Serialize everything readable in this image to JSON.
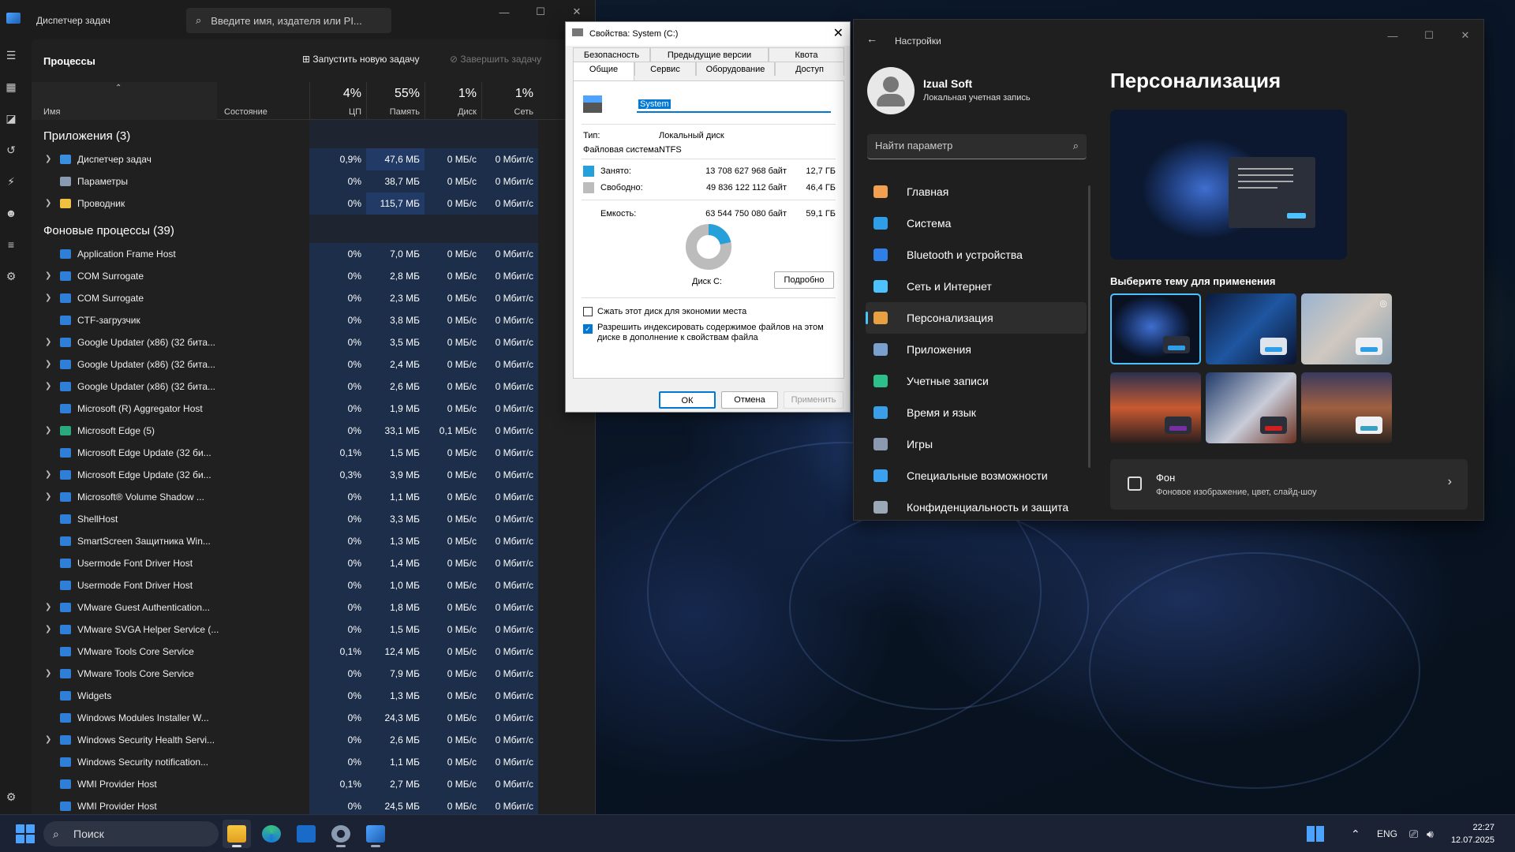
{
  "task_manager": {
    "title": "Диспетчер задач",
    "search_placeholder": "Введите имя, издателя или PI...",
    "section": "Процессы",
    "run_task": "Запустить новую задачу",
    "end_task": "Завершить задачу",
    "columns": {
      "name": "Имя",
      "status": "Состояние",
      "cpu_pct": "4%",
      "cpu": "ЦП",
      "mem_pct": "55%",
      "mem": "Память",
      "disk_pct": "1%",
      "disk": "Диск",
      "net_pct": "1%",
      "net": "Сеть"
    },
    "apps_group": "Приложения (3)",
    "bg_group": "Фоновые процессы (39)",
    "apps": [
      {
        "name": "Диспетчер задач",
        "expand": true,
        "cpu": "0,9%",
        "mem": "47,6 МБ",
        "disk": "0 МБ/с",
        "net": "0 Мбит/с",
        "icon": "task-manager-icon"
      },
      {
        "name": "Параметры",
        "expand": false,
        "cpu": "0%",
        "mem": "38,7 МБ",
        "disk": "0 МБ/с",
        "net": "0 Мбит/с",
        "icon": "settings-gear-icon"
      },
      {
        "name": "Проводник",
        "expand": true,
        "cpu": "0%",
        "mem": "115,7 МБ",
        "disk": "0 МБ/с",
        "net": "0 Мбит/с",
        "icon": "folder-icon"
      }
    ],
    "background": [
      {
        "name": "Application Frame Host",
        "expand": false,
        "cpu": "0%",
        "mem": "7,0 МБ",
        "disk": "0 МБ/с",
        "net": "0 Мбит/с"
      },
      {
        "name": "COM Surrogate",
        "expand": true,
        "cpu": "0%",
        "mem": "2,8 МБ",
        "disk": "0 МБ/с",
        "net": "0 Мбит/с"
      },
      {
        "name": "COM Surrogate",
        "expand": true,
        "cpu": "0%",
        "mem": "2,3 МБ",
        "disk": "0 МБ/с",
        "net": "0 Мбит/с"
      },
      {
        "name": "CTF-загрузчик",
        "expand": false,
        "cpu": "0%",
        "mem": "3,8 МБ",
        "disk": "0 МБ/с",
        "net": "0 Мбит/с"
      },
      {
        "name": "Google Updater (x86) (32 бита...",
        "expand": true,
        "cpu": "0%",
        "mem": "3,5 МБ",
        "disk": "0 МБ/с",
        "net": "0 Мбит/с"
      },
      {
        "name": "Google Updater (x86) (32 бита...",
        "expand": true,
        "cpu": "0%",
        "mem": "2,4 МБ",
        "disk": "0 МБ/с",
        "net": "0 Мбит/с"
      },
      {
        "name": "Google Updater (x86) (32 бита...",
        "expand": true,
        "cpu": "0%",
        "mem": "2,6 МБ",
        "disk": "0 МБ/с",
        "net": "0 Мбит/с"
      },
      {
        "name": "Microsoft (R) Aggregator Host",
        "expand": false,
        "cpu": "0%",
        "mem": "1,9 МБ",
        "disk": "0 МБ/с",
        "net": "0 Мбит/с"
      },
      {
        "name": "Microsoft Edge (5)",
        "expand": true,
        "cpu": "0%",
        "mem": "33,1 МБ",
        "disk": "0,1 МБ/с",
        "net": "0 Мбит/с"
      },
      {
        "name": "Microsoft Edge Update (32 би...",
        "expand": false,
        "cpu": "0,1%",
        "mem": "1,5 МБ",
        "disk": "0 МБ/с",
        "net": "0 Мбит/с"
      },
      {
        "name": "Microsoft Edge Update (32 би...",
        "expand": true,
        "cpu": "0,3%",
        "mem": "3,9 МБ",
        "disk": "0 МБ/с",
        "net": "0 Мбит/с"
      },
      {
        "name": "Microsoft® Volume Shadow ...",
        "expand": true,
        "cpu": "0%",
        "mem": "1,1 МБ",
        "disk": "0 МБ/с",
        "net": "0 Мбит/с"
      },
      {
        "name": "ShellHost",
        "expand": false,
        "cpu": "0%",
        "mem": "3,3 МБ",
        "disk": "0 МБ/с",
        "net": "0 Мбит/с"
      },
      {
        "name": "SmartScreen Защитника Win...",
        "expand": false,
        "cpu": "0%",
        "mem": "1,3 МБ",
        "disk": "0 МБ/с",
        "net": "0 Мбит/с"
      },
      {
        "name": "Usermode Font Driver Host",
        "expand": false,
        "cpu": "0%",
        "mem": "1,4 МБ",
        "disk": "0 МБ/с",
        "net": "0 Мбит/с"
      },
      {
        "name": "Usermode Font Driver Host",
        "expand": false,
        "cpu": "0%",
        "mem": "1,0 МБ",
        "disk": "0 МБ/с",
        "net": "0 Мбит/с"
      },
      {
        "name": "VMware Guest Authentication...",
        "expand": true,
        "cpu": "0%",
        "mem": "1,8 МБ",
        "disk": "0 МБ/с",
        "net": "0 Мбит/с"
      },
      {
        "name": "VMware SVGA Helper Service (...",
        "expand": true,
        "cpu": "0%",
        "mem": "1,5 МБ",
        "disk": "0 МБ/с",
        "net": "0 Мбит/с"
      },
      {
        "name": "VMware Tools Core Service",
        "expand": false,
        "cpu": "0,1%",
        "mem": "12,4 МБ",
        "disk": "0 МБ/с",
        "net": "0 Мбит/с"
      },
      {
        "name": "VMware Tools Core Service",
        "expand": true,
        "cpu": "0%",
        "mem": "7,9 МБ",
        "disk": "0 МБ/с",
        "net": "0 Мбит/с"
      },
      {
        "name": "Widgets",
        "expand": false,
        "cpu": "0%",
        "mem": "1,3 МБ",
        "disk": "0 МБ/с",
        "net": "0 Мбит/с"
      },
      {
        "name": "Windows Modules Installer W...",
        "expand": false,
        "cpu": "0%",
        "mem": "24,3 МБ",
        "disk": "0 МБ/с",
        "net": "0 Мбит/с"
      },
      {
        "name": "Windows Security Health Servi...",
        "expand": true,
        "cpu": "0%",
        "mem": "2,6 МБ",
        "disk": "0 МБ/с",
        "net": "0 Мбит/с"
      },
      {
        "name": "Windows Security notification...",
        "expand": false,
        "cpu": "0%",
        "mem": "1,1 МБ",
        "disk": "0 МБ/с",
        "net": "0 Мбит/с"
      },
      {
        "name": "WMI Provider Host",
        "expand": false,
        "cpu": "0,1%",
        "mem": "2,7 МБ",
        "disk": "0 МБ/с",
        "net": "0 Мбит/с"
      },
      {
        "name": "WMI Provider Host",
        "expand": false,
        "cpu": "0%",
        "mem": "24,5 МБ",
        "disk": "0 МБ/с",
        "net": "0 Мбит/с"
      }
    ]
  },
  "properties": {
    "title": "Свойства: System (C:)",
    "tabs_row1": [
      "Безопасность",
      "Предыдущие версии",
      "Квота"
    ],
    "tabs_row2": [
      "Общие",
      "Сервис",
      "Оборудование",
      "Доступ"
    ],
    "label_value": "System",
    "type_label": "Тип:",
    "type_value": "Локальный диск",
    "fs_label": "Файловая система:",
    "fs_value": "NTFS",
    "used_label": "Занято:",
    "used_bytes": "13 708 627 968 байт",
    "used_gb": "12,7 ГБ",
    "free_label": "Свободно:",
    "free_bytes": "49 836 122 112 байт",
    "free_gb": "46,4 ГБ",
    "cap_label": "Емкость:",
    "cap_bytes": "63 544 750 080 байт",
    "cap_gb": "59,1 ГБ",
    "used_fraction": 0.216,
    "disk_label": "Диск C:",
    "details_btn": "Подробно",
    "compress": "Сжать этот диск для экономии места",
    "index": "Разрешить индексировать содержимое файлов на этом диске в дополнение к свойствам файла",
    "ok": "ОК",
    "cancel": "Отмена",
    "apply": "Применить",
    "used_color": "#26a0da",
    "free_color": "#bcbcbc"
  },
  "settings": {
    "title": "Настройки",
    "user_name": "Izual Soft",
    "user_sub": "Локальная учетная запись",
    "find": "Найти параметр",
    "nav": [
      {
        "label": "Главная",
        "icon": "home-icon",
        "color": "#f0a050"
      },
      {
        "label": "Система",
        "icon": "system-icon",
        "color": "#2f9ee8"
      },
      {
        "label": "Bluetooth и устройства",
        "icon": "bluetooth-icon",
        "color": "#2f7fe8"
      },
      {
        "label": "Сеть и Интернет",
        "icon": "network-icon",
        "color": "#4cc2ff"
      },
      {
        "label": "Персонализация",
        "icon": "brush-icon",
        "color": "#e8a040"
      },
      {
        "label": "Приложения",
        "icon": "apps-icon",
        "color": "#7aa0d0"
      },
      {
        "label": "Учетные записи",
        "icon": "accounts-icon",
        "color": "#2ec08a"
      },
      {
        "label": "Время и язык",
        "icon": "time-language-icon",
        "color": "#3a9ee8"
      },
      {
        "label": "Игры",
        "icon": "games-icon",
        "color": "#8a9ab0"
      },
      {
        "label": "Специальные возможности",
        "icon": "accessibility-icon",
        "color": "#3aa0f0"
      },
      {
        "label": "Конфиденциальность и защита",
        "icon": "shield-icon",
        "color": "#9aa8b8"
      }
    ],
    "heading": "Персонализация",
    "theme_label": "Выберите тему для применения",
    "background_title": "Фон",
    "background_sub": "Фоновое изображение, цвет, слайд-шоу"
  },
  "taskbar": {
    "search": "Поиск",
    "lang": "ENG",
    "time": "22:27",
    "date": "12.07.2025"
  }
}
